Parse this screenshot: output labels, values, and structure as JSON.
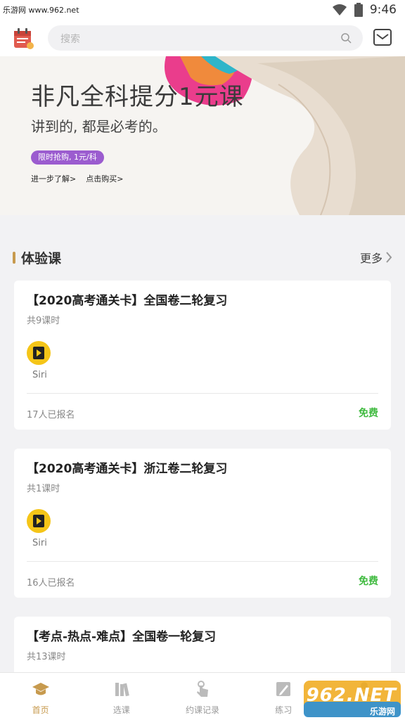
{
  "status_bar": {
    "watermark": "乐游网 www.962.net",
    "time": "9:46"
  },
  "header": {
    "search_placeholder": "搜索"
  },
  "banner": {
    "title": "非凡全科提分1元课",
    "subtitle": "讲到的, 都是必考的。",
    "badge": "限时抢购, 1元/科",
    "link_more": "进一步了解>",
    "link_buy": "点击购买>"
  },
  "section": {
    "title": "体验课",
    "more": "更多"
  },
  "courses": [
    {
      "title": "【2020高考通关卡】全国卷二轮复习",
      "lessons": "共9课时",
      "teacher": "Siri",
      "enrolled": "17人已报名",
      "price": "免费"
    },
    {
      "title": "【2020高考通关卡】浙江卷二轮复习",
      "lessons": "共1课时",
      "teacher": "Siri",
      "enrolled": "16人已报名",
      "price": "免费"
    },
    {
      "title": "【考点-热点-难点】全国卷一轮复习",
      "lessons": "共13课时"
    }
  ],
  "bottom_nav": [
    {
      "label": "首页",
      "icon": "graduation-cap-icon",
      "active": true
    },
    {
      "label": "选课",
      "icon": "books-icon"
    },
    {
      "label": "约课记录",
      "icon": "tap-hand-icon"
    },
    {
      "label": "练习",
      "icon": "pencil-paper-icon"
    },
    {
      "label": "",
      "icon": "profile-icon"
    }
  ],
  "watermark_962": {
    "text": "962.NET",
    "sub": "乐游网"
  },
  "colors": {
    "accent": "#c79a4e",
    "free": "#3fba3f",
    "badge": "#9b5ccf"
  }
}
